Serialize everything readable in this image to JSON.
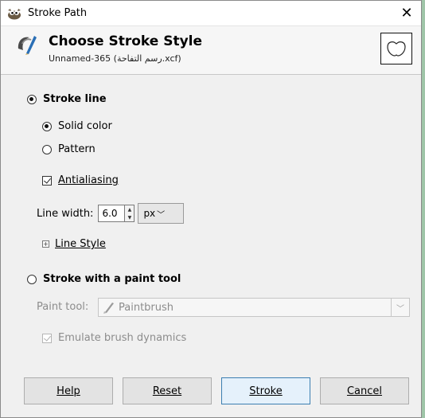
{
  "window": {
    "title": "Stroke Path",
    "close_glyph": "✕"
  },
  "header": {
    "title": "Choose Stroke Style",
    "subtitle": "Unnamed-365 (رسم التفاحة.xcf)"
  },
  "stroke_line": {
    "label": "Stroke line",
    "selected": true
  },
  "fill_mode": {
    "solid_color": "Solid color",
    "pattern": "Pattern",
    "selected": "Solid color"
  },
  "antialiasing": {
    "label": "Antialiasing",
    "checked": true
  },
  "line_width": {
    "label": "Line width:",
    "value": "6.0",
    "unit": "px"
  },
  "line_style": {
    "label": "Line Style",
    "expander": "⊞"
  },
  "stroke_with_tool": {
    "label": "Stroke with a paint tool",
    "selected": false
  },
  "paint_tool": {
    "label": "Paint tool:",
    "value": "Paintbrush"
  },
  "emulate_dynamics": {
    "label": "Emulate brush dynamics",
    "checked": true
  },
  "buttons": {
    "help": "Help",
    "reset": "Reset",
    "stroke": "Stroke",
    "cancel": "Cancel"
  }
}
